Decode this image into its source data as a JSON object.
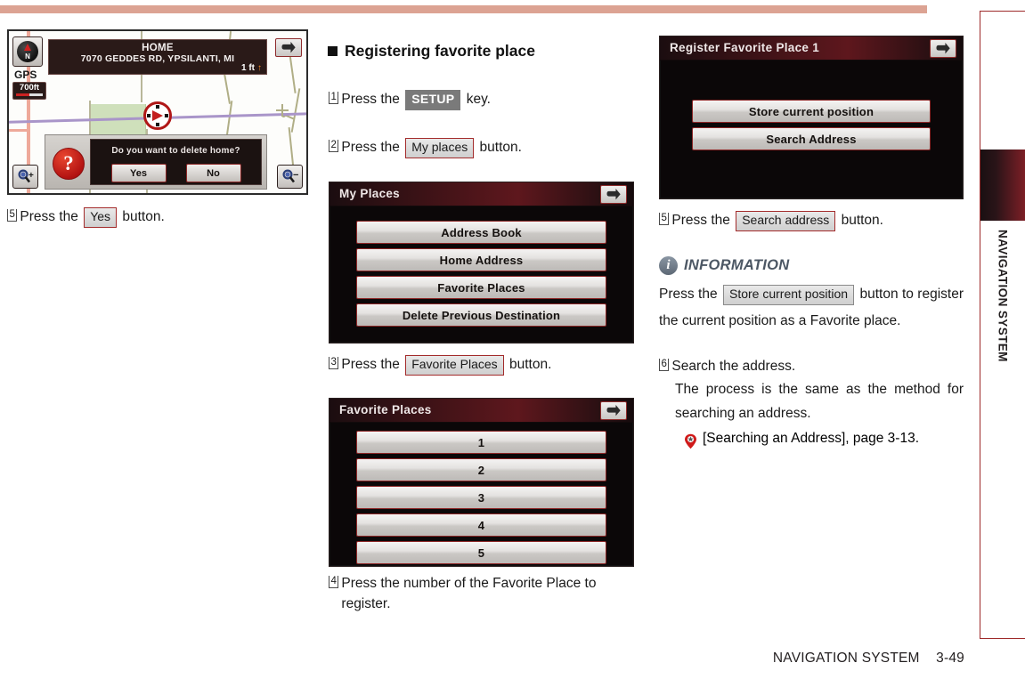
{
  "document": {
    "footer_section": "NAVIGATION SYSTEM",
    "footer_page": "3-49",
    "side_tab_label": "NAVIGATION SYSTEM"
  },
  "column1": {
    "map_screen": {
      "gps_label": "GPS",
      "scale_label": "700ft",
      "compass_letter": "N",
      "title_line1": "HOME",
      "title_line2": "7070 GEDDES RD, YPSILANTI, MI",
      "distance": "1 ft",
      "distance_arrow": "↑",
      "dialog": {
        "icon": "question-mark",
        "message": "Do you want to delete home?",
        "yes_label": "Yes",
        "no_label": "No"
      },
      "zoom_in": "zoom-in-icon",
      "zoom_out": "zoom-out-icon",
      "back_icon": "back-arrow-icon"
    },
    "step5": {
      "number": "5",
      "pre": "Press the",
      "chip": "Yes",
      "post": "button."
    }
  },
  "column2": {
    "heading": "Registering favorite place",
    "step1": {
      "number": "1",
      "pre": "Press the",
      "chip": "SETUP",
      "post": "key."
    },
    "step2": {
      "number": "2",
      "pre": "Press the",
      "chip": "My places",
      "post": "button."
    },
    "my_places_screen": {
      "title": "My Places",
      "back_icon": "back-arrow-icon",
      "buttons": [
        "Address Book",
        "Home Address",
        "Favorite Places",
        "Delete Previous Destination"
      ]
    },
    "step3": {
      "number": "3",
      "pre": "Press the",
      "chip": "Favorite Places",
      "post": "button."
    },
    "favorite_places_screen": {
      "title": "Favorite Places",
      "back_icon": "back-arrow-icon",
      "buttons": [
        "1",
        "2",
        "3",
        "4",
        "5"
      ]
    },
    "step4": {
      "number": "4",
      "text": "Press the number of the Favorite Place to register."
    }
  },
  "column3": {
    "register_screen": {
      "title": "Register Favorite Place 1",
      "back_icon": "back-arrow-icon",
      "buttons": [
        "Store current position",
        "Search Address"
      ]
    },
    "step5": {
      "number": "5",
      "pre": "Press the",
      "chip": "Search address",
      "post": "button."
    },
    "information": {
      "icon": "info-icon",
      "title": "INFORMATION",
      "pre": "Press the",
      "chip": "Store current position",
      "post": "button to register the current position as a Favorite place."
    },
    "step6": {
      "number": "6",
      "line1": "Search the address.",
      "line2": "The process is the same as the method for searching an address."
    },
    "reference": {
      "icon": "map-pin-icon",
      "text": "[Searching an Address], page 3-13."
    }
  },
  "colors": {
    "top_rule": "#dca393",
    "tab_border": "#9e2a2a",
    "chip_border": "#a32b2b",
    "info_title": "#4c5764",
    "key_chip_bg": "#7a7a7a"
  }
}
